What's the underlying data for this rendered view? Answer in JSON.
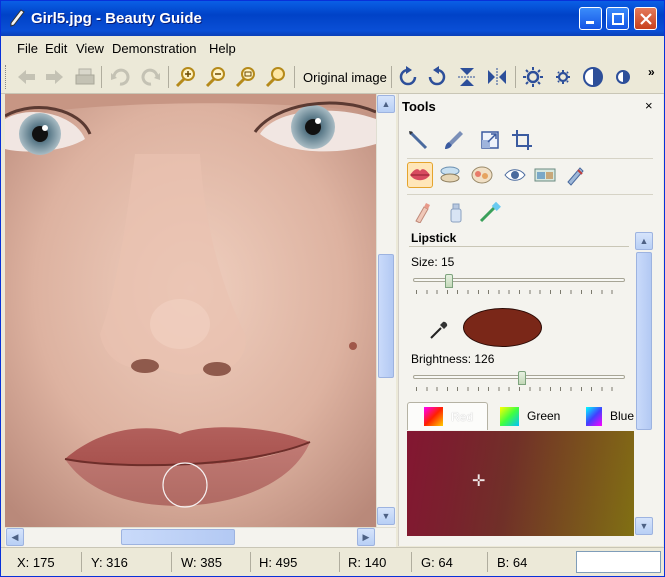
{
  "window": {
    "title": "Girl5.jpg - Beauty Guide"
  },
  "menu": [
    "File",
    "Edit",
    "View",
    "Demonstration",
    "Help"
  ],
  "toolbar": {
    "original_image_label": "Original image",
    "overflow_label": "»"
  },
  "tools_panel": {
    "title": "Tools",
    "close_label": "×",
    "section_title": "Lipstick",
    "size_label": "Size: 15",
    "size_value": 15,
    "brightness_label": "Brightness: 126",
    "brightness_value": 126,
    "swatch_color": "#7a2718",
    "tabs": [
      "Red",
      "Green",
      "Blue"
    ],
    "active_tab": "Red"
  },
  "status": {
    "x": "X: 175",
    "y": "Y: 316",
    "w": "W: 385",
    "h": "H: 495",
    "r": "R: 140",
    "g": "G: 64",
    "b": "B: 64"
  }
}
